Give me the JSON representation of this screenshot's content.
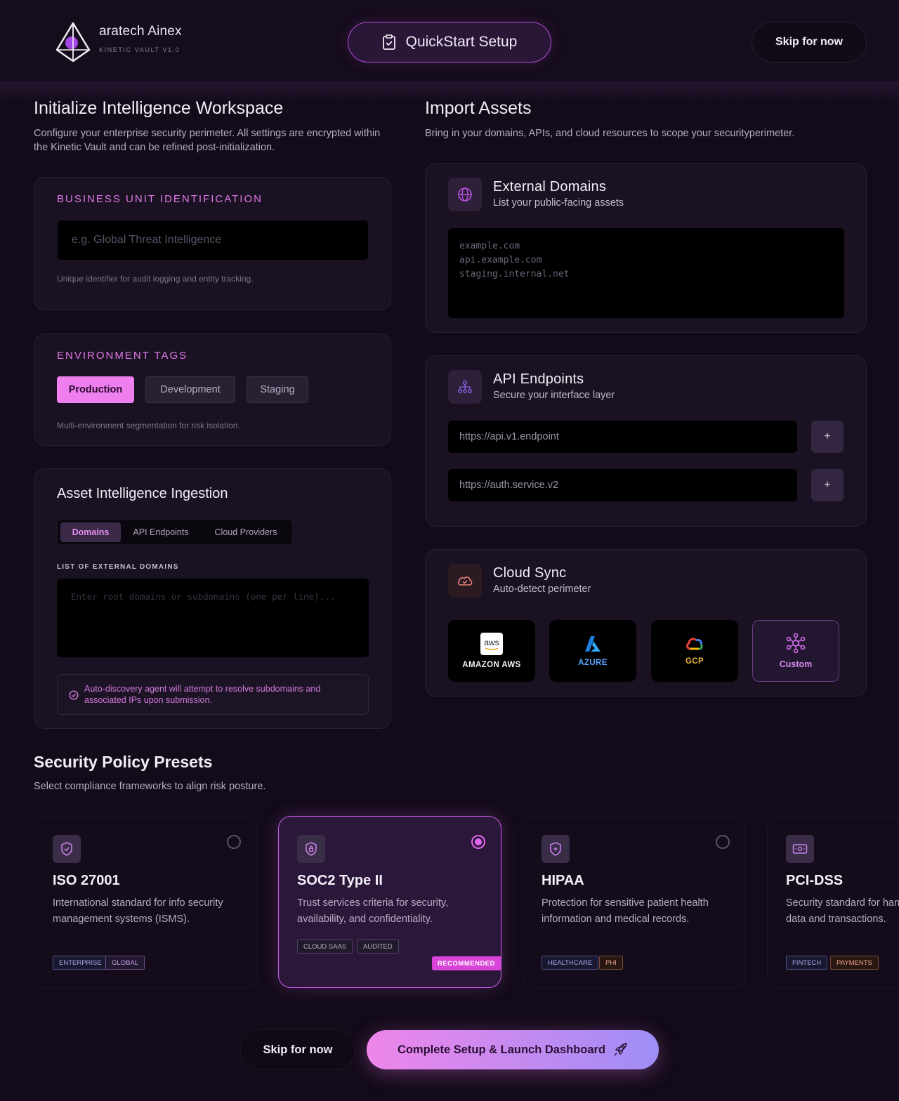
{
  "header": {
    "brand_name": "aratech Ainex",
    "brand_sub": "KINETIC VAULT V1.0",
    "quickstart_label": "QuickStart Setup",
    "skip_label": "Skip for now"
  },
  "workspace": {
    "title": "Initialize Intelligence Workspace",
    "description": "Configure your enterprise security perimeter. All settings are encrypted within the Kinetic Vault and can be refined post-initialization.",
    "business_unit": {
      "label": "BUSINESS UNIT IDENTIFICATION",
      "placeholder": "e.g. Global Threat Intelligence",
      "hint": "Unique identifier for audit logging and entity tracking."
    },
    "environment": {
      "label": "ENVIRONMENT TAGS",
      "tags": [
        "Production",
        "Development",
        "Staging"
      ],
      "selected": "Production",
      "hint": "Multi-environment segmentation for risk isolation."
    },
    "ingestion": {
      "title": "Asset Intelligence Ingestion",
      "tabs": [
        "Domains",
        "API Endpoints",
        "Cloud Providers"
      ],
      "active_tab": "Domains",
      "list_label": "LIST OF EXTERNAL DOMAINS",
      "placeholder": "Enter root domains or subdomains (one per line)...",
      "notice": "Auto-discovery agent will attempt to resolve subdomains and associated IPs upon submission."
    }
  },
  "import": {
    "title": "Import Assets",
    "description": "Bring in your domains, APIs, and cloud resources to scope your securityperimeter.",
    "external_domains": {
      "title": "External Domains",
      "subtitle": "List your public-facing assets",
      "lines": [
        "example.com",
        "api.example.com",
        "staging.internal.net"
      ]
    },
    "api_endpoints": {
      "title": "API Endpoints",
      "subtitle": "Secure your interface layer",
      "placeholders": [
        "https://api.v1.endpoint",
        "https://auth.service.v2"
      ],
      "add_label": "+"
    },
    "cloud_sync": {
      "title": "Cloud Sync",
      "subtitle": "Auto-detect perimeter",
      "providers": [
        {
          "name": "AMAZON AWS",
          "icon": "aws-logo-icon",
          "logo_text": "aws"
        },
        {
          "name": "AZURE",
          "icon": "azure-logo-icon"
        },
        {
          "name": "GCP",
          "icon": "gcp-logo-icon"
        },
        {
          "name": "Custom",
          "icon": "network-icon"
        }
      ]
    }
  },
  "policies": {
    "title": "Security Policy Presets",
    "description": "Select compliance frameworks to align risk posture.",
    "items": [
      {
        "title": "ISO 27001",
        "description": "International standard for info security management systems (ISMS).",
        "chips": [
          "ENTERPRISE",
          "GLOBAL"
        ],
        "selected": false
      },
      {
        "title": "SOC2 Type II",
        "description": "Trust services criteria for security, availability, and confidentiality.",
        "chips": [
          "CLOUD SAAS",
          "AUDITED"
        ],
        "selected": true,
        "badge": "RECOMMENDED"
      },
      {
        "title": "HIPAA",
        "description": "Protection for sensitive patient health information and medical records.",
        "chips": [
          "HEALTHCARE",
          "PHI"
        ],
        "selected": false
      },
      {
        "title": "PCI-DSS",
        "description": "Security standard for handling credit card data and transactions.",
        "chips": [
          "FINTECH",
          "PAYMENTS"
        ],
        "selected": false
      }
    ]
  },
  "footer": {
    "skip_label": "Skip for now",
    "launch_label": "Complete Setup & Launch Dashboard"
  },
  "colors": {
    "accent": "#e07ae8",
    "background": "#130b19",
    "card": "#1a1122"
  }
}
